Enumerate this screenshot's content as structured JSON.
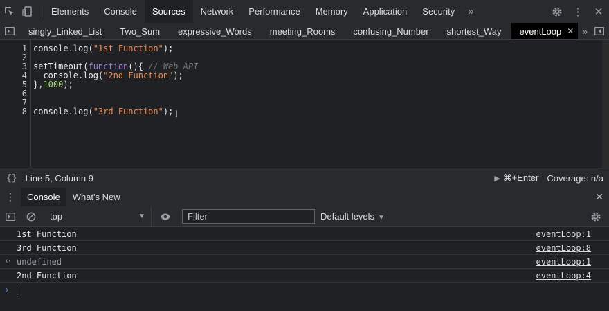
{
  "top_tabs": [
    "Elements",
    "Console",
    "Sources",
    "Network",
    "Performance",
    "Memory",
    "Application",
    "Security"
  ],
  "active_top_tab": "Sources",
  "file_tabs": [
    "singly_Linked_List",
    "Two_Sum",
    "expressive_Words",
    "meeting_Rooms",
    "confusing_Number",
    "shortest_Way",
    "eventLoop"
  ],
  "active_file_tab": "eventLoop",
  "code_lines": [
    {
      "n": "1",
      "parts": [
        [
          "plain",
          "console.log("
        ],
        [
          "str",
          "\"1st Function\""
        ],
        [
          "plain",
          ");"
        ]
      ]
    },
    {
      "n": "2",
      "parts": []
    },
    {
      "n": "3",
      "parts": [
        [
          "plain",
          "setTimeout("
        ],
        [
          "fn",
          "function"
        ],
        [
          "plain",
          "(){ "
        ],
        [
          "com",
          "// Web API"
        ]
      ]
    },
    {
      "n": "4",
      "parts": [
        [
          "plain",
          "  console.log("
        ],
        [
          "str",
          "\"2nd Function\""
        ],
        [
          "plain",
          ");"
        ]
      ]
    },
    {
      "n": "5",
      "parts": [
        [
          "plain",
          "},"
        ],
        [
          "num",
          "1000"
        ],
        [
          "plain",
          ");"
        ]
      ]
    },
    {
      "n": "6",
      "parts": []
    },
    {
      "n": "7",
      "parts": []
    },
    {
      "n": "8",
      "parts": [
        [
          "plain",
          "console.log("
        ],
        [
          "str",
          "\"3rd Function\""
        ],
        [
          "plain",
          ");"
        ]
      ]
    }
  ],
  "status": {
    "braces": "{}",
    "position": "Line 5, Column 9",
    "run": "⌘+Enter",
    "coverage": "Coverage: n/a"
  },
  "drawer_tabs": [
    "Console",
    "What's New"
  ],
  "console_toolbar": {
    "context": "top",
    "filter_placeholder": "Filter",
    "levels": "Default levels"
  },
  "console_messages": [
    {
      "text": "1st Function",
      "source": "eventLoop:1",
      "kind": "log"
    },
    {
      "text": "3rd Function",
      "source": "eventLoop:8",
      "kind": "log"
    },
    {
      "text": "undefined",
      "source": "eventLoop:1",
      "kind": "result"
    },
    {
      "text": "2nd Function",
      "source": "eventLoop:4",
      "kind": "log"
    }
  ]
}
